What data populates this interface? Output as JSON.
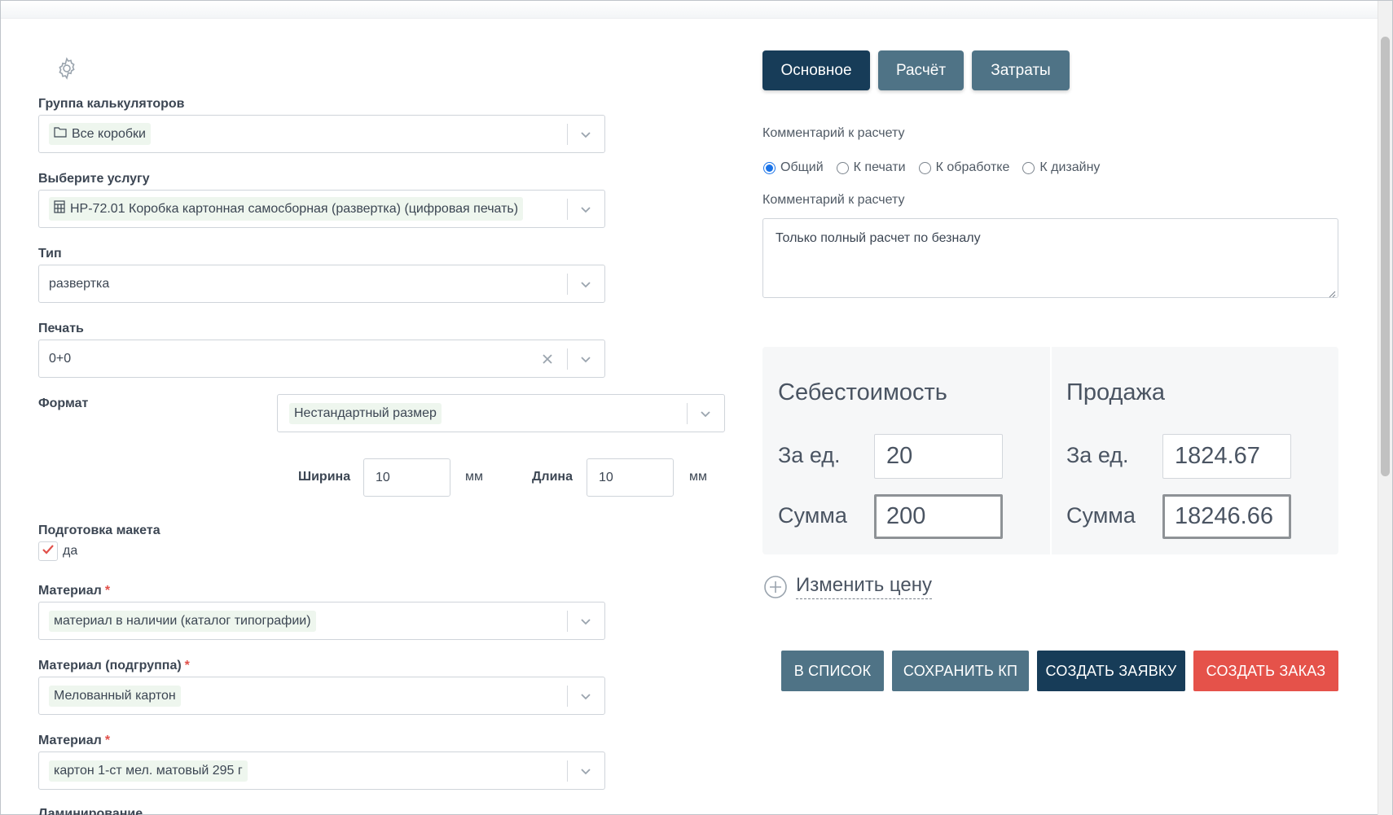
{
  "left_form": {
    "calculator_group": {
      "label": "Группа калькуляторов",
      "value": "Все коробки",
      "icon": "folder-icon"
    },
    "service": {
      "label": "Выберите услугу",
      "value": "НР-72.01 Коробка картонная самосборная (развертка) (цифровая печать)",
      "icon": "calculator-icon"
    },
    "type": {
      "label": "Тип",
      "value": "развертка"
    },
    "print": {
      "label": "Печать",
      "value": "0+0"
    },
    "format": {
      "label": "Формат",
      "value": "Нестандартный размер"
    },
    "width": {
      "label": "Ширина",
      "value": "10",
      "unit": "мм"
    },
    "length": {
      "label": "Длина",
      "value": "10",
      "unit": "мм"
    },
    "layout_prep": {
      "label": "Подготовка макета",
      "checkbox_label": "да",
      "checked": true
    },
    "material": {
      "label": "Материал",
      "required_mark": "*",
      "value": "материал в наличии (каталог типографии)"
    },
    "material_subgroup": {
      "label": "Материал (подгруппа)",
      "required_mark": "*",
      "value": "Мелованный картон"
    },
    "material_item": {
      "label": "Материал",
      "required_mark": "*",
      "value": "картон 1-ст мел. матовый 295 г"
    },
    "lamination_cut": {
      "label": "Ламинирование"
    }
  },
  "tabs": [
    {
      "label": "Основное",
      "active": true
    },
    {
      "label": "Расчёт",
      "active": false
    },
    {
      "label": "Затраты",
      "active": false
    }
  ],
  "comment": {
    "section_label": "Комментарий к расчету",
    "radios": [
      {
        "label": "Общий",
        "checked": true
      },
      {
        "label": "К печати",
        "checked": false
      },
      {
        "label": "К обработке",
        "checked": false
      },
      {
        "label": "К дизайну",
        "checked": false
      }
    ],
    "field_label": "Комментарий к расчету",
    "text": "Только полный расчет по безналу"
  },
  "pricing": {
    "cost": {
      "title": "Себестоимость",
      "per_unit_label": "За ед.",
      "per_unit": "20",
      "total_label": "Сумма",
      "total": "200"
    },
    "sale": {
      "title": "Продажа",
      "per_unit_label": "За ед.",
      "per_unit": "1824.67",
      "total_label": "Сумма",
      "total": "18246.66"
    },
    "change_price_label": "Изменить цену"
  },
  "actions": {
    "to_list": "В СПИСОК",
    "save_kp": "СОХРАНИТЬ КП",
    "create_request": "СОЗДАТЬ ЗАЯВКУ",
    "create_order": "СОЗДАТЬ ЗАКАЗ"
  },
  "colors": {
    "navy": "#173c58",
    "slate": "#4f7386",
    "red": "#e5524a",
    "required": "#e1504a"
  }
}
